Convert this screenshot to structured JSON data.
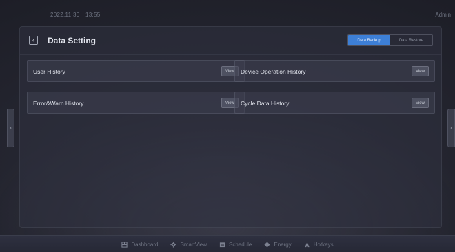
{
  "topbar": {
    "date": "2022.11.30",
    "time": "13:55",
    "user": "Admin"
  },
  "page": {
    "back_icon": "chevron-left-icon",
    "title": "Data Setting",
    "tabs": [
      {
        "label": "Data Backup",
        "active": true
      },
      {
        "label": "Data Restore",
        "active": false
      }
    ]
  },
  "cards": [
    {
      "label": "User History",
      "button": "View"
    },
    {
      "label": "Device Operation History",
      "button": "View"
    },
    {
      "label": "Error&Warn History",
      "button": "View"
    },
    {
      "label": "Cycle Data History",
      "button": "View"
    }
  ],
  "nav": {
    "items": [
      {
        "label": "Dashboard",
        "icon": "dashboard-icon"
      },
      {
        "label": "SmartView",
        "icon": "gear-icon"
      },
      {
        "label": "Schedule",
        "icon": "calendar-icon"
      },
      {
        "label": "Energy",
        "icon": "diamond-icon"
      },
      {
        "label": "Hotkeys",
        "icon": "key-icon"
      }
    ]
  },
  "colors": {
    "accent": "#3d7fd6",
    "background": "#22232d"
  }
}
